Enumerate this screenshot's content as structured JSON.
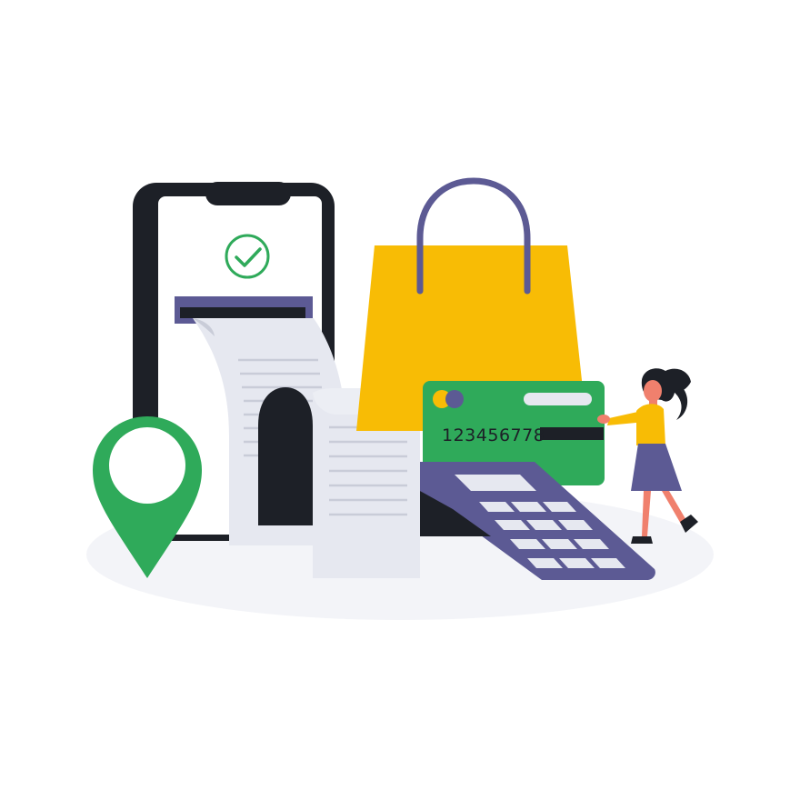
{
  "scene": {
    "description_icons": [
      "smartphone-icon",
      "check-circle-icon",
      "receipt-icon",
      "location-pin-icon",
      "shopping-bag-icon",
      "credit-card-icon",
      "card-terminal-icon",
      "woman-figure"
    ],
    "colors": {
      "background": "#ffffff",
      "ground": "#f3f4f8",
      "phone_frame": "#1d2027",
      "phone_screen": "#ffffff",
      "check": "#2faa5a",
      "receipt_paper": "#e6e8f0",
      "receipt_lines": "#c9ccd8",
      "slot": "#5c5a94",
      "pin": "#2faa5a",
      "bag": "#f8bc05",
      "bag_handle": "#5c5a94",
      "card": "#2faa5a",
      "card_chip_dark": "#5c5a94",
      "card_chip_light": "#f8bc05",
      "card_stripe": "#1d2027",
      "terminal": "#5c5a94",
      "terminal_keys": "#e6e8f0",
      "woman_top": "#f8bc05",
      "woman_skirt": "#5c5a94",
      "woman_skin": "#f0806d",
      "woman_hair": "#1d2027"
    }
  },
  "card": {
    "number": "123456778"
  }
}
